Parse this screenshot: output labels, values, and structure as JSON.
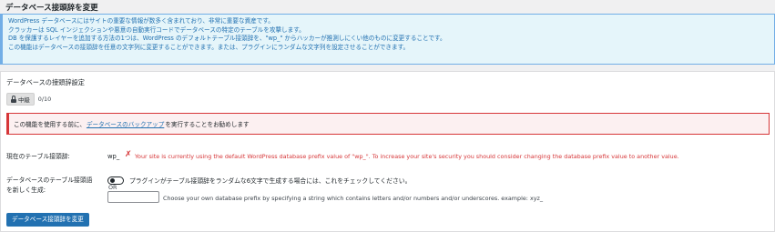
{
  "page": {
    "title": "データベース接頭辞を変更"
  },
  "info": {
    "lines": [
      "WordPress データベースにはサイトの重要な情報が数多く含まれており、非常に重要な資産です。",
      "クラッカーは SQL インジェクションや悪意の自動実行コードでデータベースの特定のテーブルを攻撃します。",
      "DB を保護するレイヤーを追加する方法の1つは、WordPress のデフォルトテーブル接頭辞を、\"wp_\" からハッカーが推測しにくい他のものに変更することです。",
      "この機能はデータベースの接頭辞を任意の文字列に変更することができます。または、プラグインにランダムな文字列を設定させることができます。"
    ]
  },
  "settings": {
    "title": "データベースの接頭辞設定",
    "level": {
      "icon": "lock-icon",
      "label": "中級",
      "score": "0/10"
    },
    "warning": {
      "prefix": "この機能を使用する前に、",
      "link": "データベースのバックアップ",
      "suffix": "を実行することをお勧めします"
    },
    "current_prefix": {
      "label": "現在のテーブル接頭辞:",
      "value": "wp_",
      "error_icon": "x-mark-icon",
      "error_text": "Your site is currently using the default WordPress database prefix value of \"wp_\". To increase your site's security you should consider changing the database prefix value to another value."
    },
    "new_prefix": {
      "label_line1": "データベースのテーブル接頭語",
      "label_line2": "を新しく生成:",
      "toggle_label": "プラグインがテーブル接頭辞をランダムな6文字で生成する場合には、これをチェックしてください。",
      "toggle_on": false,
      "or": "OR",
      "input_value": "",
      "input_help": "Choose your own database prefix by specifying a string which contains letters and/or numbers and/or underscores. example: xyz_"
    },
    "submit_label": "データベース接頭辞を変更"
  },
  "colors": {
    "info_border": "#72aee6",
    "info_bg": "#e5f5fa",
    "error": "#d63638",
    "primary": "#2271b1"
  }
}
